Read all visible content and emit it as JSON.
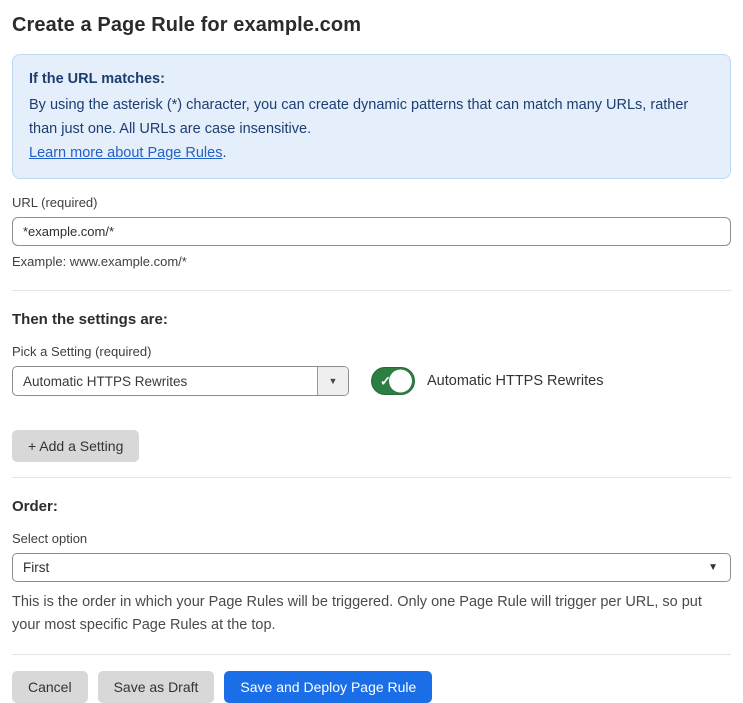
{
  "page": {
    "title": "Create a Page Rule for example.com"
  },
  "info_box": {
    "heading": "If the URL matches:",
    "body": "By using the asterisk (*) character, you can create dynamic patterns that can match many URLs, rather than just one. All URLs are case insensitive.",
    "link_label": "Learn more about Page Rules",
    "link_suffix": "."
  },
  "url_field": {
    "label": "URL (required)",
    "value": "*example.com/*",
    "helper": "Example: www.example.com/*"
  },
  "settings_section": {
    "heading": "Then the settings are:",
    "picker_label": "Pick a Setting (required)",
    "picker_value": "Automatic HTTPS Rewrites",
    "picker_caret_icon": "▼",
    "toggle_state": "on",
    "toggle_check_icon": "✓",
    "toggle_label": "Automatic HTTPS Rewrites",
    "add_setting_label": "+ Add a Setting"
  },
  "order_section": {
    "heading": "Order:",
    "select_label": "Select option",
    "select_value": "First",
    "select_caret_icon": "▼",
    "helper": "This is the order in which your Page Rules will be triggered. Only one Page Rule will trigger per URL, so put your most specific Page Rules at the top."
  },
  "footer": {
    "cancel_label": "Cancel",
    "save_draft_label": "Save as Draft",
    "save_deploy_label": "Save and Deploy Page Rule"
  },
  "colors": {
    "primary_button_blue": "#1a6ee8",
    "toggle_green": "#2e7d43",
    "info_box_bg": "#e4effb",
    "info_box_border": "#bdd9f2",
    "info_text_navy": "#1e3d70",
    "link_blue": "#2261c9",
    "secondary_button_gray": "#d8d8d8"
  }
}
